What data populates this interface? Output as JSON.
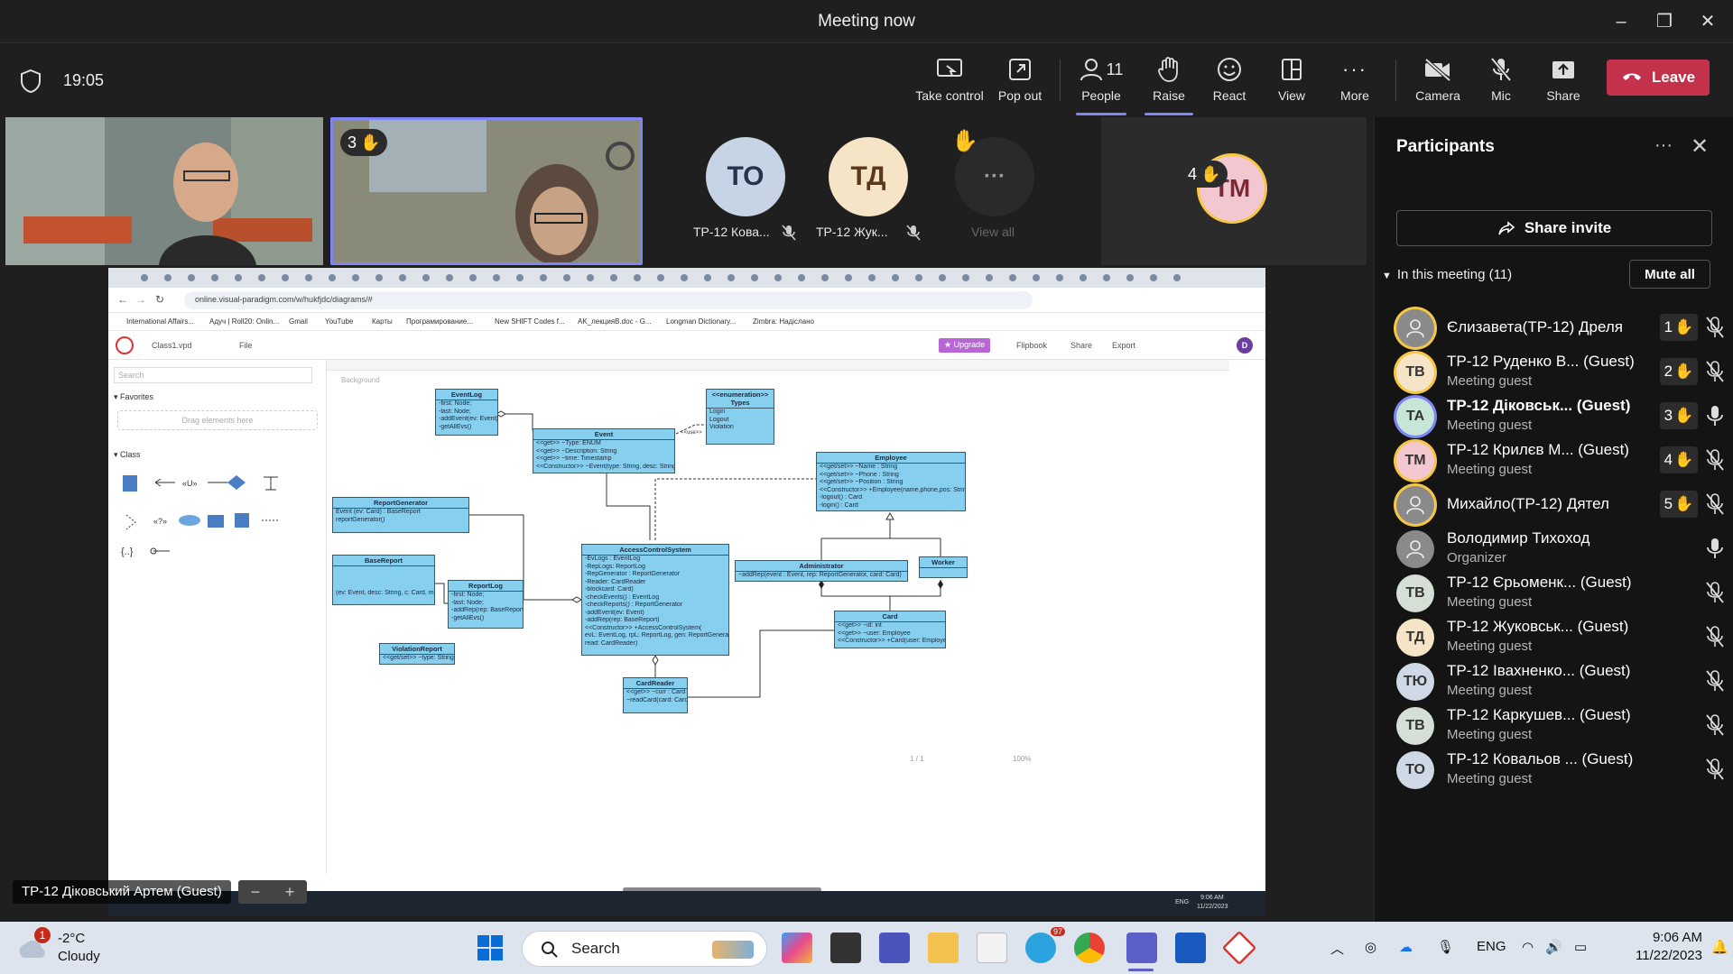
{
  "window": {
    "title": "Meeting now"
  },
  "toolbar": {
    "timer": "19:05",
    "take_control": "Take control",
    "pop_out": "Pop out",
    "people": "People",
    "people_count": "11",
    "raise": "Raise",
    "react": "React",
    "view": "View",
    "more": "More",
    "camera": "Camera",
    "mic": "Mic",
    "share": "Share",
    "leave": "Leave"
  },
  "tiles": {
    "cam2_hand_count": "3",
    "to_initials": "ТО",
    "to_name": "ТР-12 Кова...",
    "td_initials": "ТД",
    "td_name": "ТР-12 Жук...",
    "view_all": "View all",
    "tm_initials": "TM",
    "tm_hand_count": "4"
  },
  "speaker": {
    "label": "ТР-12 Діковський Артем (Guest)"
  },
  "shared_screen": {
    "url": "online.visual-paradigm.com/w/hukfjdc/diagrams/#",
    "bookmarks": [
      "International Affairs...",
      "Адуч | Roll20: Onlin...",
      "Gmail",
      "YouTube",
      "Карты",
      "Програмирование...",
      "New SHIFT Codes f...",
      "AK_лекцияB.doc - G...",
      "Longman Dictionary...",
      "Zimbra: Надіслано"
    ],
    "file_name": "Class1.vpd",
    "file_menu": "File",
    "upgrade": "Upgrade",
    "flipbook": "Flipbook",
    "share": "Share",
    "export": "Export",
    "user_initial": "D",
    "search_placeholder": "Search",
    "favorites": "Favorites",
    "drag_here": "Drag elements here",
    "class_group": "Class",
    "background": "Background",
    "page_indicator": "1 / 1",
    "zoom": "100%",
    "scr_time": "9:06 AM",
    "scr_date": "11/22/2023",
    "scr_lang": "ENG"
  },
  "uml": {
    "eventlog": {
      "title": "EventLog",
      "rows": [
        "-first: Node;",
        "-last: Node;",
        "-addEvent(ev: Event)",
        "-getAllEvs()"
      ]
    },
    "types": {
      "stereo": "<<enumeration>>",
      "title": "Types",
      "rows": [
        "Login",
        "Logout",
        "Violation"
      ]
    },
    "event": {
      "title": "Event",
      "rows": [
        "<<get>> ~Type: ENUM",
        "<<get>> ~Description: String",
        "<<get>> ~time: Timestamp",
        "<<Constructor>> ~Event(type: String, desc: String)"
      ]
    },
    "employee": {
      "title": "Employee",
      "rows": [
        "<<get/set>> ~Name : String",
        "<<get/set>> ~Phone : String",
        "<<get/set>> ~Position : String",
        "<<Constructor>> +Employee(name,phone,pos: String)",
        "-logout() : Card",
        "-login() : Card"
      ]
    },
    "reportgen": {
      "title": "ReportGenerator",
      "rows": [
        "Event (ev: Card) : BaseReport",
        "reportGenerator()"
      ]
    },
    "acs": {
      "title": "AccessControlSystem",
      "rows": [
        "-EvLogs : EventLog",
        "-RepLogs: ReportLog",
        "-RepGenerator : ReportGenerator",
        "-Reader: CardReader",
        "-blockcard: Card)",
        "-checkEvents() : EventLog",
        "-checkReports() : ReportGenerator",
        "-addEvent(ev: Event)",
        "-addRep(rep: BaseReport)",
        "<<Constructor>> +AccessControlSystem(",
        "evL: EventLog, rpL: ReportLog, gen: ReportGenerator,",
        "read: CardReader)"
      ]
    },
    "admin": {
      "title": "Administrator",
      "rows": [
        "~addRep(event : Event, rep: ReportGenerator, card: Card)"
      ]
    },
    "worker": {
      "title": "Worker"
    },
    "reportlog": {
      "title": "ReportLog",
      "rows": [
        "-first: Node;",
        "-last: Node;",
        "-addRep(rep: BaseReport)",
        "-getAllEvs()"
      ]
    },
    "basereport": {
      "title": "BaseReport",
      "rows": [
        "(ev: Event, desc: String, c: Card, m: int)"
      ]
    },
    "violation": {
      "title": "ViolationReport",
      "rows": [
        "<<get/set>> ~type: String"
      ]
    },
    "card": {
      "title": "Card",
      "rows": [
        "<<get>> ~id: int",
        "<<get>> ~user: Employee",
        "<<Constructor>> +Card(user: Employee)"
      ]
    },
    "cardreader": {
      "title": "CardReader",
      "rows": [
        "<<get>> ~curr : Card",
        "~readCard(card: Card)"
      ]
    },
    "uses_label": "<<use>>"
  },
  "panel": {
    "title": "Participants",
    "share_invite": "Share invite",
    "in_meeting": "In this meeting (11)",
    "mute_all": "Mute all",
    "participants": [
      {
        "initials": "",
        "name": "Єлизавета(ТР-12) Дреля",
        "role": "",
        "hand": "1",
        "bold": false,
        "color": "#8a8a8a",
        "ring": "#f6c744",
        "mic_on": false
      },
      {
        "initials": "ТВ",
        "name": "ТР-12 Руденко В... (Guest)",
        "role": "Meeting guest",
        "hand": "2",
        "bold": false,
        "color": "#f6e4c6",
        "ring": "#f6c744",
        "mic_on": false
      },
      {
        "initials": "ТА",
        "name": "ТР-12 Діковськ... (Guest)",
        "role": "Meeting guest",
        "hand": "3",
        "bold": true,
        "color": "#c8e6d7",
        "ring": "#7f85f5",
        "mic_on": true
      },
      {
        "initials": "ТМ",
        "name": "ТР-12 Крилєв М... (Guest)",
        "role": "Meeting guest",
        "hand": "4",
        "bold": false,
        "color": "#f2c7cf",
        "ring": "#f6c744",
        "mic_on": false
      },
      {
        "initials": "",
        "name": "Михайло(ТР-12) Дятел",
        "role": "",
        "hand": "5",
        "bold": false,
        "color": "#8a8a8a",
        "ring": "#f6c744",
        "mic_on": false
      },
      {
        "initials": "",
        "name": "Володимир Тихоход",
        "role": "Organizer",
        "hand": "",
        "bold": false,
        "color": "#8a8a8a",
        "ring": "",
        "mic_on": true
      },
      {
        "initials": "ТВ",
        "name": "ТР-12 Єрьоменк... (Guest)",
        "role": "Meeting guest",
        "hand": "",
        "bold": false,
        "color": "#d5dfd5",
        "ring": "",
        "mic_on": false
      },
      {
        "initials": "ТД",
        "name": "ТР-12 Жуковськ... (Guest)",
        "role": "Meeting guest",
        "hand": "",
        "bold": false,
        "color": "#f6e4c6",
        "ring": "",
        "mic_on": false
      },
      {
        "initials": "ТЮ",
        "name": "ТР-12 Івахненко... (Guest)",
        "role": "Meeting guest",
        "hand": "",
        "bold": false,
        "color": "#cfd9e6",
        "ring": "",
        "mic_on": false
      },
      {
        "initials": "ТВ",
        "name": "ТР-12 Каркушев... (Guest)",
        "role": "Meeting guest",
        "hand": "",
        "bold": false,
        "color": "#d5dfd5",
        "ring": "",
        "mic_on": false
      },
      {
        "initials": "ТО",
        "name": "ТР-12 Ковальов ... (Guest)",
        "role": "Meeting guest",
        "hand": "",
        "bold": false,
        "color": "#cfd9e6",
        "ring": "",
        "mic_on": false
      }
    ]
  },
  "taskbar": {
    "notif_count": "1",
    "temp": "-2°C",
    "condition": "Cloudy",
    "search": "Search",
    "lang": "ENG",
    "time": "9:06 AM",
    "date": "11/22/2023",
    "telegram_badge": "97"
  }
}
